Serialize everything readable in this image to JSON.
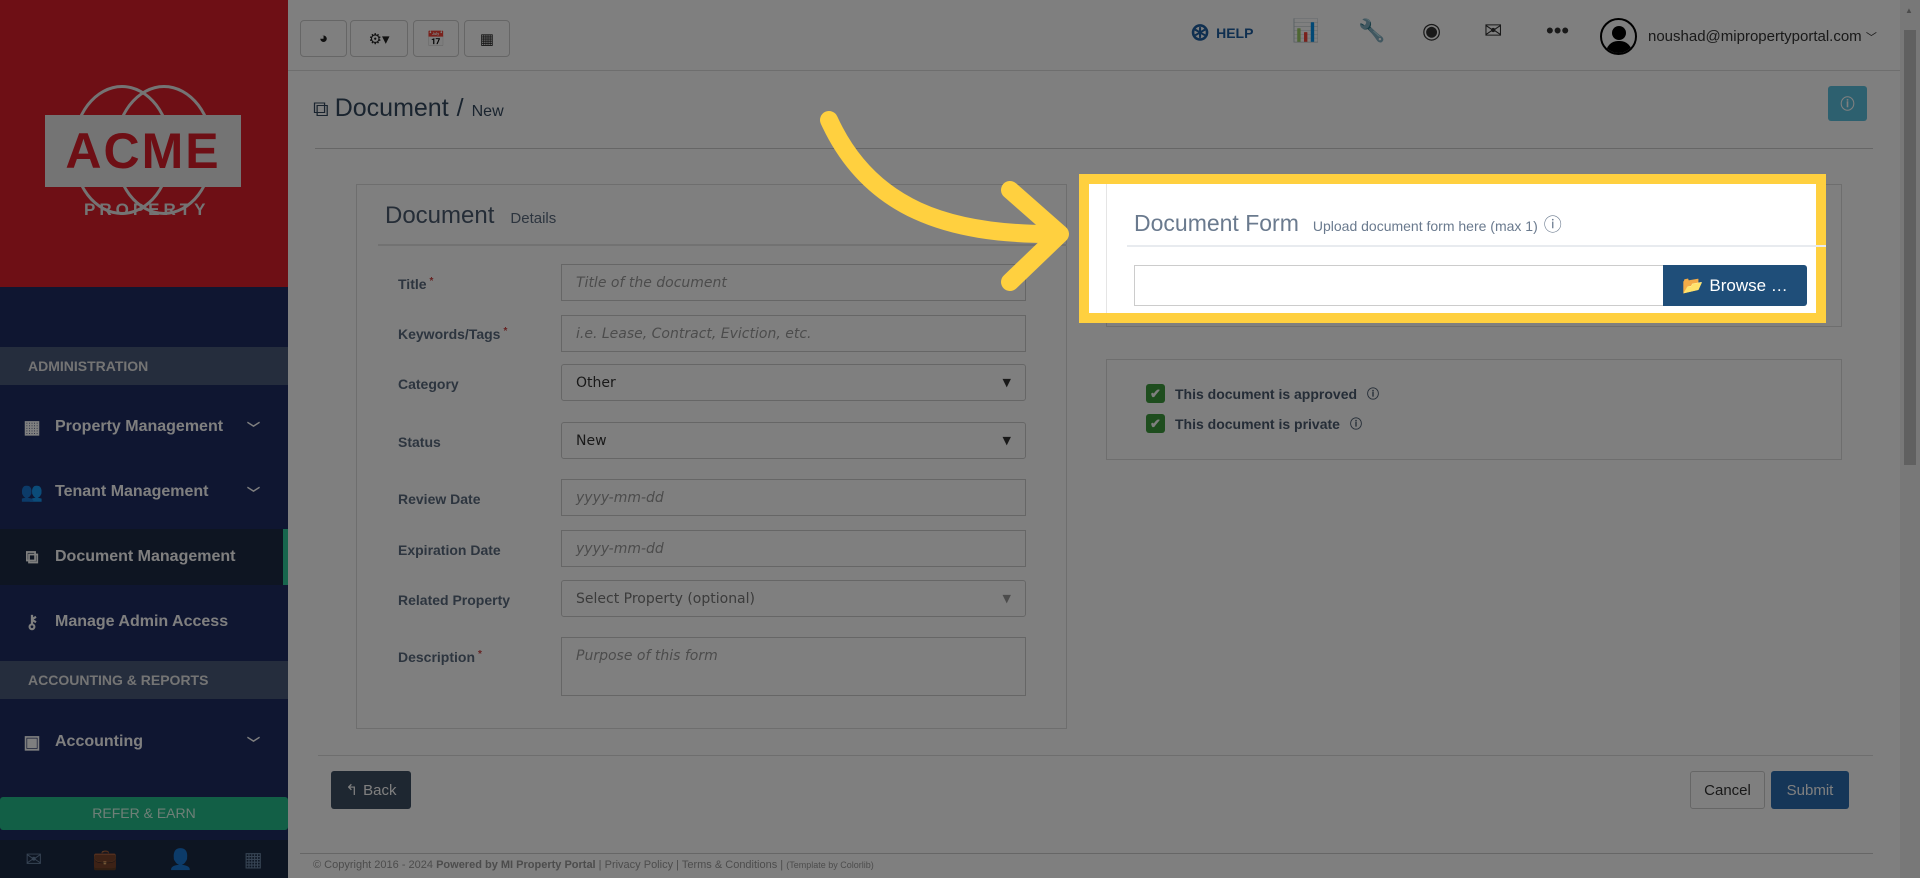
{
  "brand": {
    "logo_text": "ACME",
    "logo_sub": "PROPERTY"
  },
  "sidebar": {
    "sections": [
      {
        "label": "ADMINISTRATION"
      },
      {
        "label": "ACCOUNTING & REPORTS"
      }
    ],
    "items": [
      {
        "label": "Property Management",
        "icon": "building-icon"
      },
      {
        "label": "Tenant Management",
        "icon": "users-icon"
      },
      {
        "label": "Document Management",
        "icon": "copy-icon",
        "active": true
      },
      {
        "label": "Manage Admin Access",
        "icon": "key-icon"
      },
      {
        "label": "Accounting",
        "icon": "money-icon"
      }
    ],
    "refer_label": "REFER & EARN",
    "bottom_icons": [
      "envelope-icon",
      "briefcase-icon",
      "user-icon",
      "calculator-icon"
    ]
  },
  "topbar": {
    "help_label": "HELP",
    "user_email": "noushad@mipropertyportal.com"
  },
  "page": {
    "title": "Document",
    "separator": "/",
    "subtitle": "New"
  },
  "details": {
    "title": "Document",
    "subtitle": "Details",
    "fields": {
      "title": {
        "label": "Title",
        "placeholder": "Title of the document"
      },
      "keywords": {
        "label": "Keywords/Tags",
        "placeholder": "i.e. Lease, Contract, Eviction, etc."
      },
      "category": {
        "label": "Category",
        "value": "Other"
      },
      "status": {
        "label": "Status",
        "value": "New"
      },
      "review": {
        "label": "Review Date",
        "placeholder": "yyyy-mm-dd"
      },
      "expiration": {
        "label": "Expiration Date",
        "placeholder": "yyyy-mm-dd"
      },
      "property": {
        "label": "Related Property",
        "placeholder": "Select Property (optional)"
      },
      "description": {
        "label": "Description",
        "placeholder": "Purpose of this form"
      }
    },
    "required_mark": "*"
  },
  "upload": {
    "title": "Document Form",
    "subtitle": "Upload document form here (max 1)",
    "browse_label": "Browse …"
  },
  "options": {
    "approved": {
      "label": "This document is approved",
      "checked": true
    },
    "private": {
      "label": "This document is private",
      "checked": true
    }
  },
  "actions": {
    "back": "Back",
    "cancel": "Cancel",
    "submit": "Submit"
  },
  "footer": {
    "copyright": "© Copyright 2016 - 2024",
    "powered": "Powered by MI Property Portal",
    "privacy": "Privacy Policy",
    "terms": "Terms & Conditions",
    "template": "(Template by Colorlib)"
  },
  "colors": {
    "highlight": "#ffd03f",
    "primary": "#1f4e79",
    "sidebar": "#1e2c62",
    "logo_bg": "#dc1f2a",
    "refer": "#24bf8c"
  }
}
